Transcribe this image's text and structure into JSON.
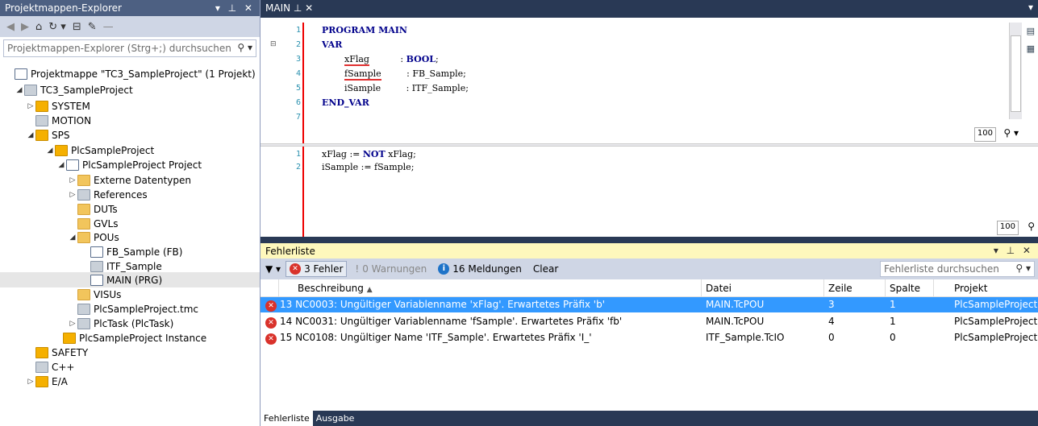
{
  "explorer": {
    "title": "Projektmappen-Explorer",
    "controls": "▾ ⊥ ✕",
    "search_placeholder": "Projektmappen-Explorer (Strg+;) durchsuchen",
    "nodes": [
      {
        "label": "Projektmappe \"TC3_SampleProject\" (1 Projekt)"
      },
      {
        "label": "TC3_SampleProject"
      },
      {
        "label": "SYSTEM"
      },
      {
        "label": "MOTION"
      },
      {
        "label": "SPS"
      },
      {
        "label": "PlcSampleProject"
      },
      {
        "label": "PlcSampleProject Project"
      },
      {
        "label": "Externe Datentypen"
      },
      {
        "label": "References"
      },
      {
        "label": "DUTs"
      },
      {
        "label": "GVLs"
      },
      {
        "label": "POUs"
      },
      {
        "label": "FB_Sample (FB)"
      },
      {
        "label": "ITF_Sample"
      },
      {
        "label": "MAIN (PRG)"
      },
      {
        "label": "VISUs"
      },
      {
        "label": "PlcSampleProject.tmc"
      },
      {
        "label": "PlcTask (PlcTask)"
      },
      {
        "label": "PlcSampleProject Instance"
      },
      {
        "label": "SAFETY"
      },
      {
        "label": "C++"
      },
      {
        "label": "E/A"
      }
    ]
  },
  "editor": {
    "tab": "MAIN",
    "tab_pin": "⊥ ✕",
    "decl_lines": [
      {
        "n": "1"
      },
      {
        "n": "2"
      },
      {
        "n": "3"
      },
      {
        "n": "4"
      },
      {
        "n": "5"
      },
      {
        "n": "6"
      },
      {
        "n": "7"
      }
    ],
    "decl": {
      "l1_kw": "PROGRAM",
      "l1_rest": " MAIN",
      "l2_kw": "VAR",
      "l3_name": "xFlag",
      "l3_sep": "           : ",
      "l3_type": "BOOL",
      "l3_end": ";",
      "l4_name": "fSample",
      "l4_rest": "         : FB_Sample;",
      "l5_name": "iSample",
      "l5_rest": "         : ITF_Sample;",
      "l6_kw": "END_VAR"
    },
    "impl_lines": [
      {
        "n": "1"
      },
      {
        "n": "2"
      }
    ],
    "impl": {
      "l1_a": "xFlag := ",
      "l1_kw": "NOT",
      "l1_b": " xFlag;",
      "l2": "iSample := fSample;"
    },
    "zoom_top": "100",
    "zoom_bottom": "100"
  },
  "errors": {
    "title": "Fehlerliste",
    "controls": "▾ ⊥ ✕",
    "filter_errors": "3 Fehler",
    "filter_warnings": "0 Warnungen",
    "filter_messages": "16 Meldungen",
    "clear": "Clear",
    "search_placeholder": "Fehlerliste durchsuchen",
    "columns": {
      "desc": "Beschreibung",
      "file": "Datei",
      "line": "Zeile",
      "col": "Spalte",
      "project": "Projekt"
    },
    "rows": [
      {
        "desc": "13  NC0003: Ungültiger Variablenname 'xFlag'. Erwartetes Präfix 'b'",
        "file": "MAIN.TcPOU",
        "line": "3",
        "col": "1",
        "project": "PlcSampleProject"
      },
      {
        "desc": "14  NC0031: Ungültiger Variablenname 'fSample'. Erwartetes Präfix 'fb'",
        "file": "MAIN.TcPOU",
        "line": "4",
        "col": "1",
        "project": "PlcSampleProject"
      },
      {
        "desc": "15  NC0108: Ungültiger Name 'ITF_Sample'. Erwartetes Präfix 'I_'",
        "file": "ITF_Sample.TcIO",
        "line": "0",
        "col": "0",
        "project": "PlcSampleProject"
      }
    ],
    "bottom_tabs": [
      "Fehlerliste",
      "Ausgabe"
    ]
  }
}
